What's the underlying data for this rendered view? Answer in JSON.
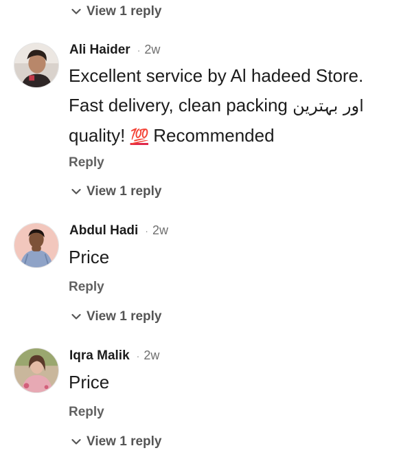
{
  "top_thread": {
    "view_replies_label": "View 1 reply"
  },
  "comments": [
    {
      "author": "Ali Haider",
      "separator": "·",
      "time": "2w",
      "text_line1": "Excellent service by Al hadeed Store.",
      "text_line2_part1": "Fast delivery, clean packing ",
      "text_line2_urdu": "اور بہترین",
      "text_line3_part1": "quality! ",
      "text_line3_emoji": "💯",
      "text_line3_part2": " Recommended",
      "reply_label": "Reply",
      "view_replies_label": "View 1 reply"
    },
    {
      "author": "Abdul Hadi",
      "separator": "·",
      "time": "2w",
      "text": "Price",
      "reply_label": "Reply",
      "view_replies_label": "View 1 reply"
    },
    {
      "author": "Iqra Malik",
      "separator": "·",
      "time": "2w",
      "text": "Price",
      "reply_label": "Reply",
      "view_replies_label": "View 1 reply"
    }
  ],
  "icons": {
    "chevron": "chevron-down-icon",
    "avatar": "avatar"
  },
  "colors": {
    "text_primary": "#1c1c1c",
    "text_secondary": "#616161",
    "link_gray": "#555555"
  }
}
